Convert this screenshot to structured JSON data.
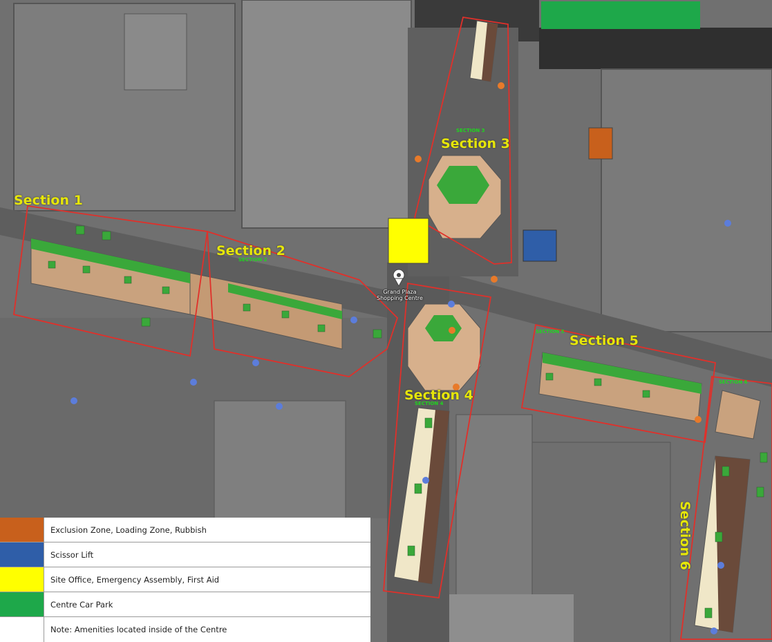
{
  "map": {
    "sections": [
      {
        "id": "1",
        "label": "Section 1",
        "small": ""
      },
      {
        "id": "2",
        "label": "Section 2",
        "small": "SECTION 2"
      },
      {
        "id": "3",
        "label": "Section 3",
        "small": "SECTION 3"
      },
      {
        "id": "4",
        "label": "Section 4",
        "small": "SECTION 4"
      },
      {
        "id": "5",
        "label": "Section 5",
        "small": "SECTION 5"
      },
      {
        "id": "6",
        "label": "Section 6",
        "small": "SECTION 6"
      }
    ],
    "centre_marker": {
      "name": "Grand Plaza\nShopping Centre"
    }
  },
  "legend": [
    {
      "color": "#c8601c",
      "label": "Exclusion Zone, Loading Zone, Rubbish"
    },
    {
      "color": "#2f5ea8",
      "label": "Scissor Lift"
    },
    {
      "color": "#ffff00",
      "label": "Site Office, Emergency Assembly, First Aid"
    },
    {
      "color": "#1ea84a",
      "label": "Centre Car Park"
    },
    {
      "color": "#ffffff",
      "label": "Note: Amenities located inside of the Centre"
    }
  ],
  "colors": {
    "exclusion": "#c8601c",
    "scissor_lift": "#2f5ea8",
    "site_office": "#ffff00",
    "car_park": "#1ea84a",
    "boundary": "#e0302a",
    "label": "#e6e60a"
  }
}
